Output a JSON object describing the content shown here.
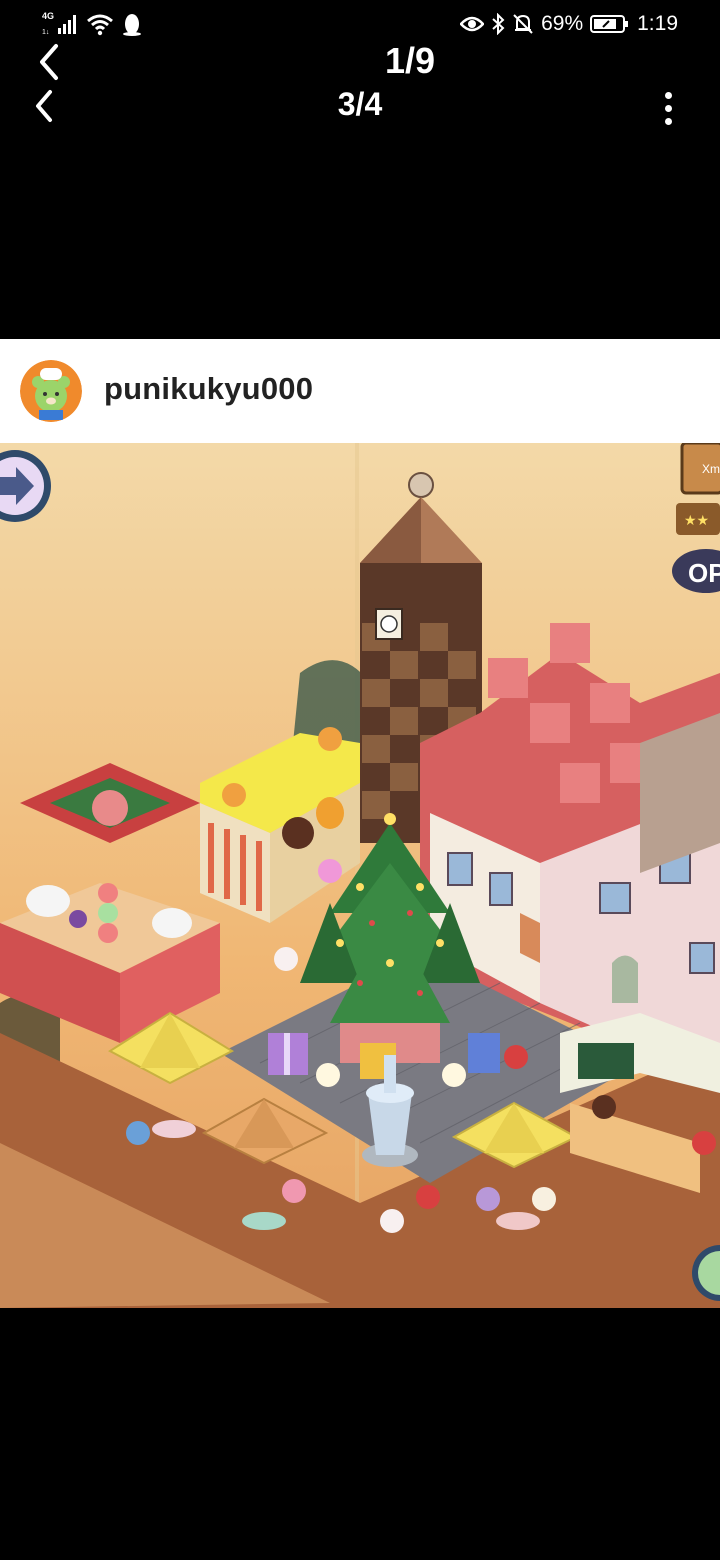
{
  "status_bar": {
    "network": "4G",
    "battery": "69%",
    "time": "1:19",
    "icons": [
      "signal-icon",
      "wifi-icon",
      "penguin-icon",
      "eye-icon",
      "bluetooth-icon",
      "mute-bell-icon",
      "battery-icon"
    ]
  },
  "viewer": {
    "album_counter": "1/9",
    "image_counter": "3/4"
  },
  "post": {
    "username": "punikukyu000"
  },
  "scene": {
    "sign_text": "OP",
    "sign_top_text": "Xm"
  }
}
